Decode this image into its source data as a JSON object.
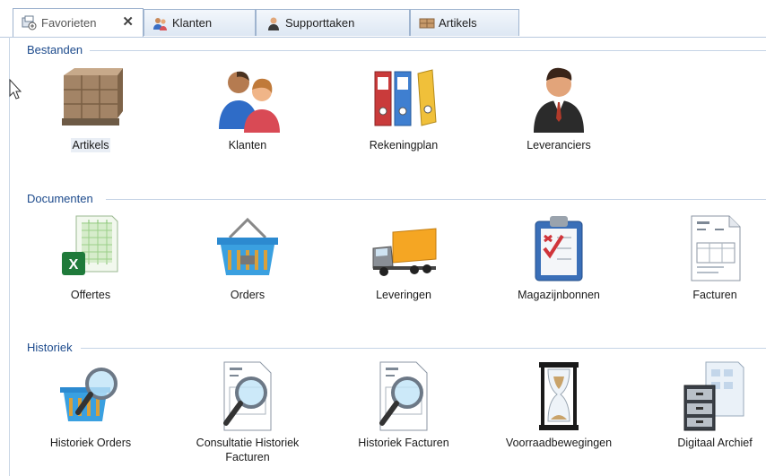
{
  "tabs": [
    {
      "label": "Favorieten",
      "icon": "favorites-icon",
      "active": true
    },
    {
      "label": "Klanten",
      "icon": "customers-icon",
      "active": false
    },
    {
      "label": "Supporttaken",
      "icon": "support-person-icon",
      "active": false
    },
    {
      "label": "Artikels",
      "icon": "pallet-icon",
      "active": false
    }
  ],
  "close_symbol": "✕",
  "groups": [
    {
      "title": "Bestanden",
      "items": [
        {
          "label": "Artikels",
          "icon": "pallet-boxes-icon"
        },
        {
          "label": "Klanten",
          "icon": "customers-icon"
        },
        {
          "label": "Rekeningplan",
          "icon": "binders-icon"
        },
        {
          "label": "Leveranciers",
          "icon": "businessman-icon"
        }
      ]
    },
    {
      "title": "Documenten",
      "items": [
        {
          "label": "Offertes",
          "icon": "spreadsheet-icon"
        },
        {
          "label": "Orders",
          "icon": "basket-icon"
        },
        {
          "label": "Leveringen",
          "icon": "truck-icon"
        },
        {
          "label": "Magazijnbonnen",
          "icon": "clipboard-checklist-icon"
        },
        {
          "label": "Facturen",
          "icon": "invoice-icon"
        }
      ]
    },
    {
      "title": "Historiek",
      "items": [
        {
          "label": "Historiek Orders",
          "icon": "basket-search-icon"
        },
        {
          "label": "Consultatie Historiek Facturen",
          "icon": "invoice-search-icon"
        },
        {
          "label": "Historiek Facturen",
          "icon": "invoice-search-icon"
        },
        {
          "label": "Voorraadbewegingen",
          "icon": "hourglass-icon"
        },
        {
          "label": "Digitaal Archief",
          "icon": "filing-cabinet-icon"
        }
      ]
    }
  ]
}
